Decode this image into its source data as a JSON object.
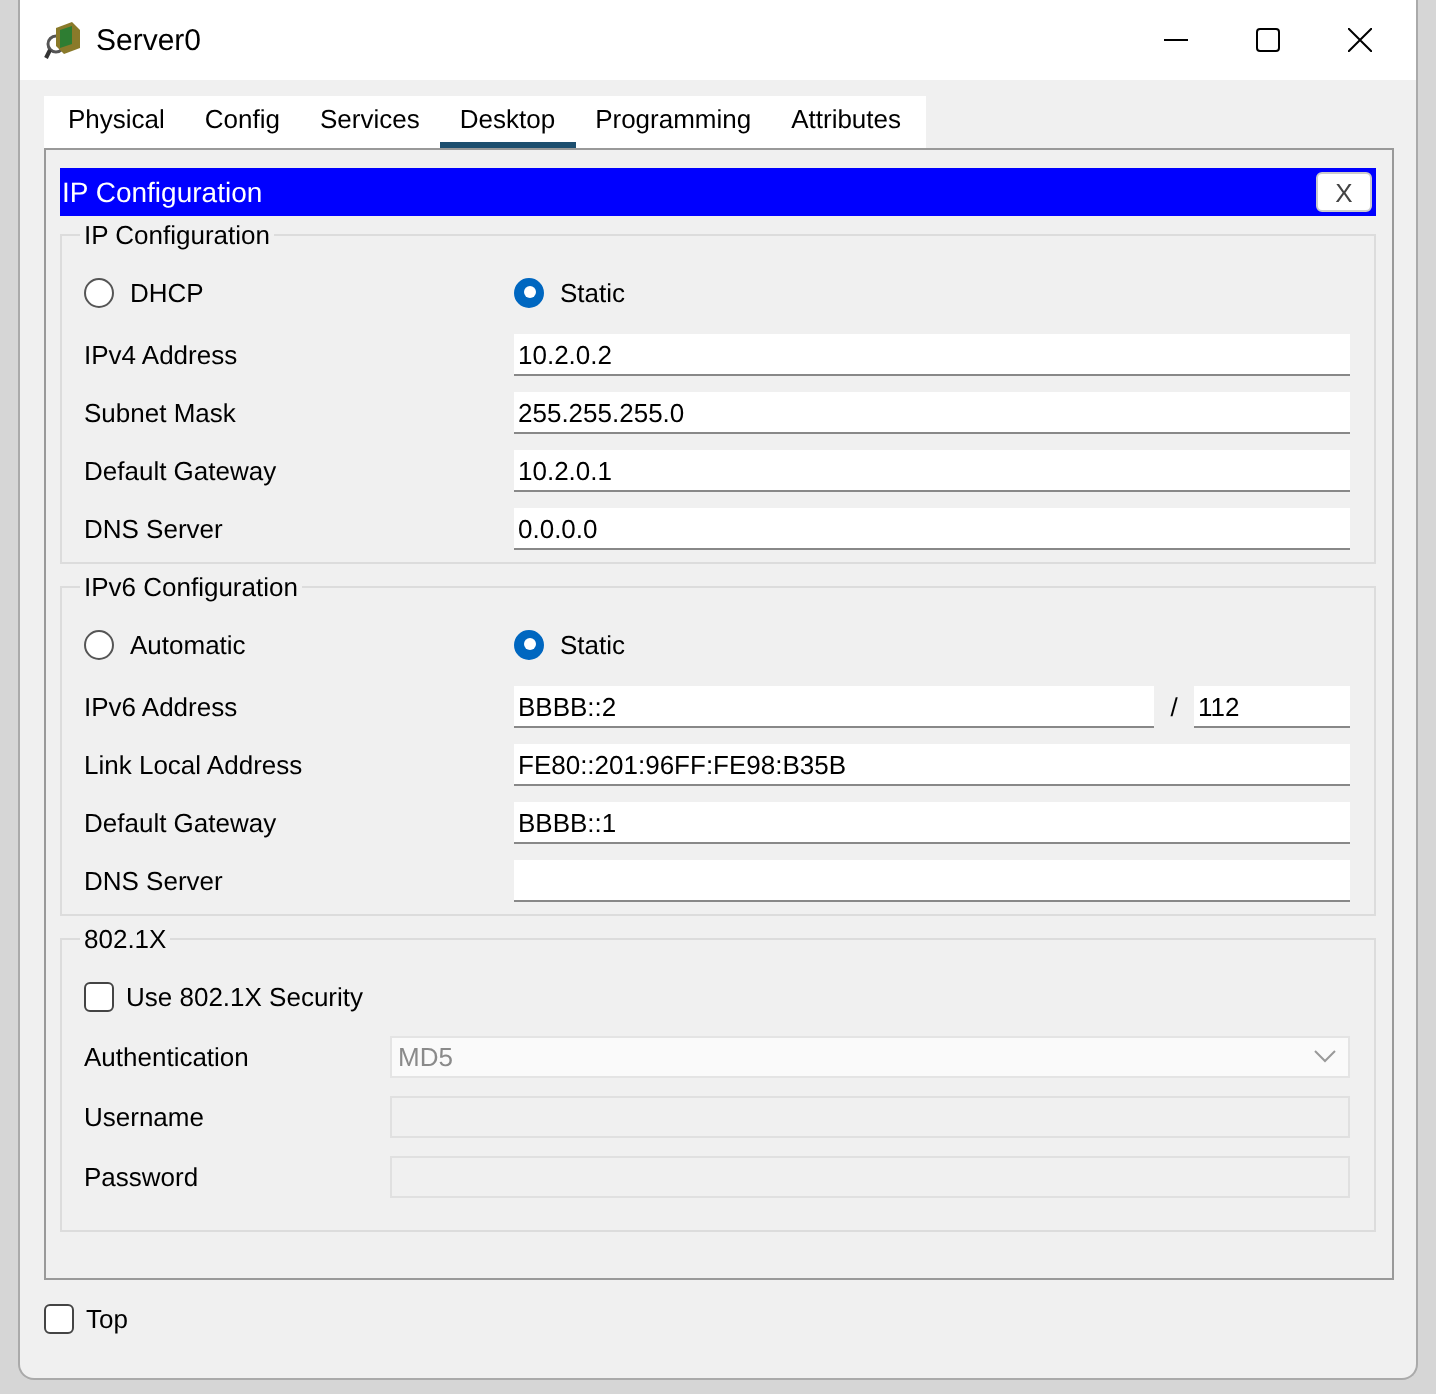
{
  "window": {
    "title": "Server0"
  },
  "tabs": [
    {
      "label": "Physical",
      "selected": false
    },
    {
      "label": "Config",
      "selected": false
    },
    {
      "label": "Services",
      "selected": false
    },
    {
      "label": "Desktop",
      "selected": true
    },
    {
      "label": "Programming",
      "selected": false
    },
    {
      "label": "Attributes",
      "selected": false
    }
  ],
  "panel": {
    "title": "IP Configuration",
    "close": "X"
  },
  "ipv4": {
    "title": "IP Configuration",
    "modes": [
      {
        "label": "DHCP",
        "selected": false
      },
      {
        "label": "Static",
        "selected": true
      }
    ],
    "fields": [
      {
        "label": "IPv4 Address",
        "value": "10.2.0.2"
      },
      {
        "label": "Subnet Mask",
        "value": "255.255.255.0"
      },
      {
        "label": "Default Gateway",
        "value": "10.2.0.1"
      },
      {
        "label": "DNS Server",
        "value": "0.0.0.0"
      }
    ]
  },
  "ipv6": {
    "title": "IPv6 Configuration",
    "modes": [
      {
        "label": "Automatic",
        "selected": false
      },
      {
        "label": "Static",
        "selected": true
      }
    ],
    "address": {
      "label": "IPv6 Address",
      "value": "BBBB::2",
      "separator": "/",
      "prefix": "112"
    },
    "fields": [
      {
        "label": "Link Local Address",
        "value": "FE80::201:96FF:FE98:B35B"
      },
      {
        "label": "Default Gateway",
        "value": "BBBB::1"
      },
      {
        "label": "DNS Server"
      }
    ]
  },
  "dot1x": {
    "title": "802.1X",
    "security": {
      "label": "Use 802.1X Security",
      "checked": false
    },
    "authentication": {
      "label": "Authentication",
      "value": "MD5",
      "disabled": true
    },
    "fields": [
      {
        "label": "Username",
        "disabled": true
      },
      {
        "label": "Password",
        "disabled": true
      }
    ]
  },
  "footer": {
    "top": {
      "label": "Top",
      "checked": false
    }
  }
}
